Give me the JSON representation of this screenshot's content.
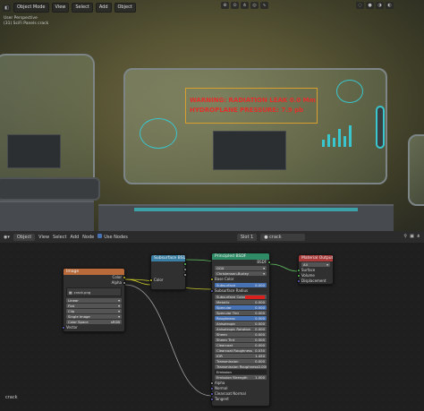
{
  "viewport": {
    "mode": "Object Mode",
    "menus": [
      "View",
      "Select",
      "Add",
      "Object"
    ],
    "info_line1": "User Perspective",
    "info_line2": "(31) SciFi Panels crack",
    "header_icons": [
      "view-icon",
      "cursor-icon",
      "global-icon",
      "snap-icon",
      "proportional-icon"
    ],
    "shading_icons": [
      "wireframe-icon",
      "solid-icon",
      "material-icon",
      "rendered-icon"
    ],
    "holo_line1": "WARNING: RADIATION LEAK 0.0 Mm",
    "holo_line2": "HYDROPLANE PRESSURE: 7.9 pb"
  },
  "node_editor": {
    "editor_type": "Object",
    "menus": [
      "View",
      "Select",
      "Add",
      "Node"
    ],
    "use_nodes_label": "Use Nodes",
    "slot": "Slot 1",
    "material": "crack",
    "footer_label": "crack"
  },
  "nodes": {
    "image": {
      "title": "Image",
      "out_color": "Color",
      "out_alpha": "Alpha",
      "image_name": "crack.png",
      "interpolation": "Linear",
      "projection": "Flat",
      "extension": "Clip",
      "source": "Single Image",
      "color_space_label": "Color Space",
      "color_space": "sRGB",
      "vector": "Vector"
    },
    "subsurface": {
      "title": "Subsurface BSDF",
      "in_color": "Color"
    },
    "principled": {
      "title": "Principled BSDF",
      "out": "BSDF",
      "distribution": "GGX",
      "subsurface_method": "Christensen-Burley",
      "rows": [
        {
          "label": "Base Color",
          "value": "",
          "style": "label"
        },
        {
          "label": "Subsurface",
          "value": "0.000",
          "style": "blue"
        },
        {
          "label": "Subsurface Radius",
          "value": "",
          "style": "label"
        },
        {
          "label": "Subsurface Color",
          "value": "",
          "style": "red"
        },
        {
          "label": "Metallic",
          "value": "0.000",
          "style": "grey"
        },
        {
          "label": "Specular",
          "value": "0.500",
          "style": "blue"
        },
        {
          "label": "Specular Tint",
          "value": "0.000",
          "style": "grey"
        },
        {
          "label": "Roughness",
          "value": "0.500",
          "style": "blue"
        },
        {
          "label": "Anisotropic",
          "value": "0.000",
          "style": "grey"
        },
        {
          "label": "Anisotropic Rotation",
          "value": "0.000",
          "style": "grey"
        },
        {
          "label": "Sheen",
          "value": "0.000",
          "style": "grey"
        },
        {
          "label": "Sheen Tint",
          "value": "0.500",
          "style": "grey"
        },
        {
          "label": "Clearcoat",
          "value": "0.000",
          "style": "grey"
        },
        {
          "label": "Clearcoat Roughness",
          "value": "0.030",
          "style": "grey"
        },
        {
          "label": "IOR",
          "value": "1.450",
          "style": "grey"
        },
        {
          "label": "Transmission",
          "value": "0.000",
          "style": "grey"
        },
        {
          "label": "Transmission Roughness",
          "value": "0.000",
          "style": "grey"
        },
        {
          "label": "Emission",
          "value": "",
          "style": "dark"
        },
        {
          "label": "Emission Strength",
          "value": "1.000",
          "style": "grey"
        },
        {
          "label": "Alpha",
          "value": "",
          "style": "label"
        },
        {
          "label": "Normal",
          "value": "",
          "style": "label"
        },
        {
          "label": "Clearcoat Normal",
          "value": "",
          "style": "label"
        },
        {
          "label": "Tangent",
          "value": "",
          "style": "label"
        }
      ]
    },
    "output": {
      "title": "Material Output",
      "target": "All",
      "inputs": [
        "Surface",
        "Volume",
        "Displacement"
      ]
    }
  },
  "colors": {
    "image_node_header": "#b86a3b",
    "shader_node_header": "#2f8a66",
    "output_node_header": "#a83a3a",
    "subsurface_header": "#3a7fa3",
    "hologram_text": "#e0302b",
    "hologram_cyan": "#39c6cf",
    "selection_blue": "#4772b3"
  }
}
